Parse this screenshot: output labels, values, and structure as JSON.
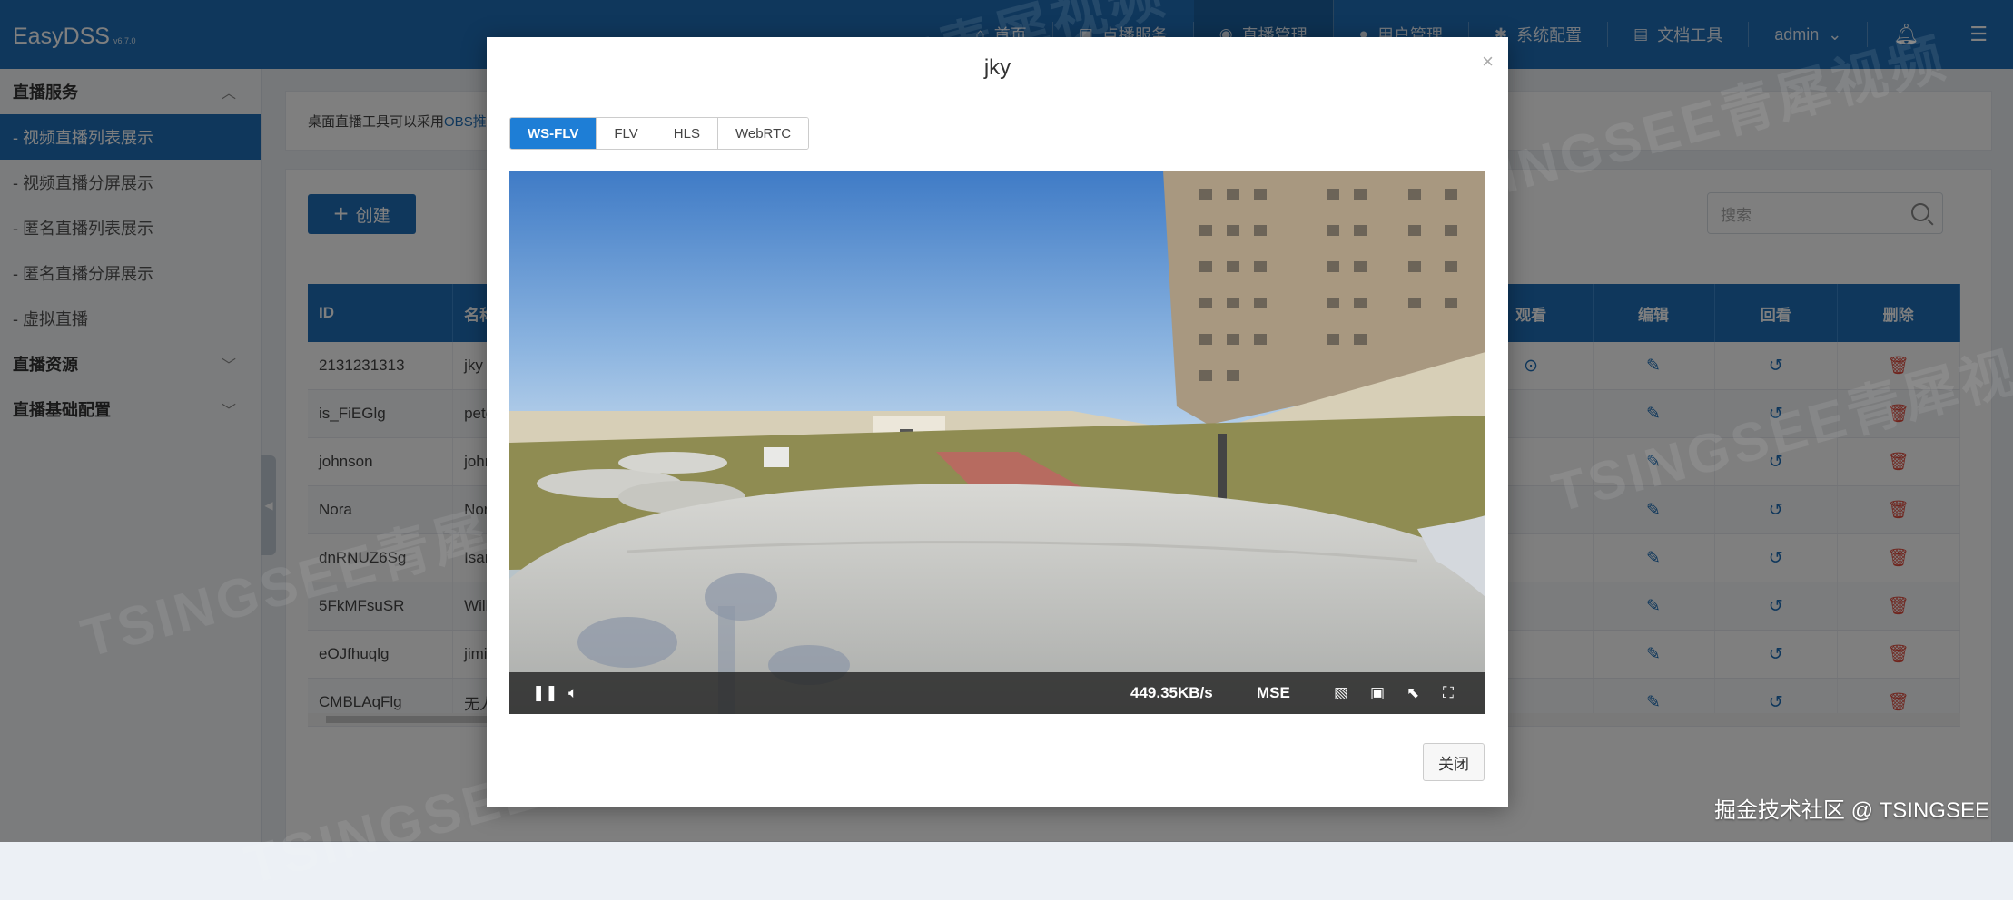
{
  "app": {
    "title": "EasyDSS",
    "version": "v6.7.0"
  },
  "nav": {
    "items": [
      {
        "label": "首页",
        "icon": "home-icon"
      },
      {
        "label": "点播服务",
        "icon": "video-icon"
      },
      {
        "label": "直播管理",
        "icon": "broadcast-icon"
      },
      {
        "label": "用户管理",
        "icon": "user-icon"
      },
      {
        "label": "系统配置",
        "icon": "gear-icon"
      },
      {
        "label": "文档工具",
        "icon": "book-icon"
      }
    ],
    "user": "admin"
  },
  "sidebar": {
    "group1": "直播服务",
    "items": [
      "- 视频直播列表展示",
      "- 视频直播分屏展示",
      "- 匿名直播列表展示",
      "- 匿名直播分屏展示",
      "- 虚拟直播"
    ],
    "group2": "直播资源",
    "group3": "直播基础配置"
  },
  "notice": {
    "text": "桌面直播工具可以采用 ",
    "link": "OBS推"
  },
  "toolbar": {
    "create": "创建",
    "search_placeholder": "搜索"
  },
  "table": {
    "headers": [
      "ID",
      "名称",
      "观看",
      "编辑",
      "回看",
      "删除"
    ],
    "rows": [
      {
        "id": "2131231313",
        "name": "jky"
      },
      {
        "id": "is_FiEGlg",
        "name": "pete"
      },
      {
        "id": "johnson",
        "name": "john"
      },
      {
        "id": "Nora",
        "name": "Nora"
      },
      {
        "id": "dnRNUZ6Sg",
        "name": "Isam"
      },
      {
        "id": "5FkMFsuSR",
        "name": "Will"
      },
      {
        "id": "eOJfhuqlg",
        "name": "jimijo"
      },
      {
        "id": "CMBLAqFlg",
        "name": "无人"
      }
    ]
  },
  "modal": {
    "title": "jky",
    "tabs": [
      "WS-FLV",
      "FLV",
      "HLS",
      "WebRTC"
    ],
    "active_tab": "WS-FLV",
    "speed": "449.35KB/s",
    "mode": "MSE",
    "close_label": "关闭"
  },
  "watermark": {
    "text": "TSINGSEE青犀视频"
  },
  "corner_caption": "掘金技术社区 @ TSINGSEE",
  "colors": {
    "primary": "#1e6fb8",
    "tab_active": "#1e7ed6",
    "danger": "#e04b3c"
  }
}
